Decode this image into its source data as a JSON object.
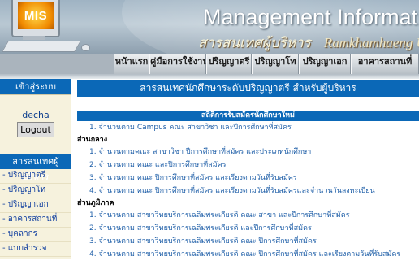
{
  "header": {
    "logo_text": "MIS",
    "title": "Management Information Syst",
    "subtitle_thai": "สารสนเทศผู้บริหาร",
    "subtitle_eng": "Ramkhamhaeng Unive"
  },
  "nav": {
    "items": [
      {
        "label": "หน้าแรก"
      },
      {
        "label": "คู่มือการใช้งาน"
      },
      {
        "label": "ปริญญาตรี"
      },
      {
        "label": "ปริญญาโท"
      },
      {
        "label": "ปริญญาเอก"
      },
      {
        "label": "อาคารสถานที่"
      }
    ]
  },
  "sidebar": {
    "login_heading": "เข้าสู่ระบบ",
    "username": "decha",
    "logout_label": "Logout",
    "info_heading": "สารสนเทศผู้บริหาร",
    "items": [
      {
        "label": "- ปริญญาตรี"
      },
      {
        "label": "- ปริญญาโท"
      },
      {
        "label": "- ปริญญาเอก"
      },
      {
        "label": "- อาคารสถานที่"
      },
      {
        "label": "- บุคลากร"
      },
      {
        "label": "- แบบสำรวจ"
      }
    ]
  },
  "main": {
    "title": "สารสนเทศนักศึกษาระดับปริญญาตรี สำหรับผู้บริหาร",
    "stats_heading": "สถิติการรับสมัครนักศึกษาใหม่",
    "top_item": "1. จำนวนตาม Campus คณะ สาขาวิชา และปีการศึกษาที่สมัคร",
    "sections": [
      {
        "label": "ส่วนกลาง",
        "items": [
          "1. จำนวนตามคณะ สาขาวิชา ปีการศึกษาที่สมัคร และประเภทนักศึกษา",
          "2. จำนวนตาม คณะ และปีการศึกษาที่สมัคร",
          "3. จำนวนตาม คณะ ปีการศึกษาที่สมัคร และเรียงตามวันที่รับสมัคร",
          "4. จำนวนตาม คณะ ปีการศึกษาที่สมัคร และเรียงตามวันที่รับสมัครและจำนวนวันลงทะเบียน"
        ]
      },
      {
        "label": "ส่วนภูมิภาค",
        "items": [
          "1. จำนวนตาม สาขาวิทยบริการเฉลิมพระเกียรติ คณะ สาขา และปีการศึกษาที่สมัคร",
          "2. จำนวนตาม สาขาวิทยบริการเฉลิมพระเกียรติ และปีการศึกษาที่สมัคร",
          "3. จำนวนตาม สาขาวิทยบริการเฉลิมพระเกียรติ คณะ ปีการศึกษาที่สมัคร",
          "4. จำนวนตาม สาขาวิทยบริการเฉลิมพระเกียรติ คณะ ปีการศึกษาที่สมัคร และเรียงตามวันที่รับสมัคร"
        ]
      }
    ]
  },
  "colors": {
    "accent_blue": "#0b68b7",
    "link_blue": "#1f5fa8",
    "sidebar_bg": "#f6f2dd"
  }
}
